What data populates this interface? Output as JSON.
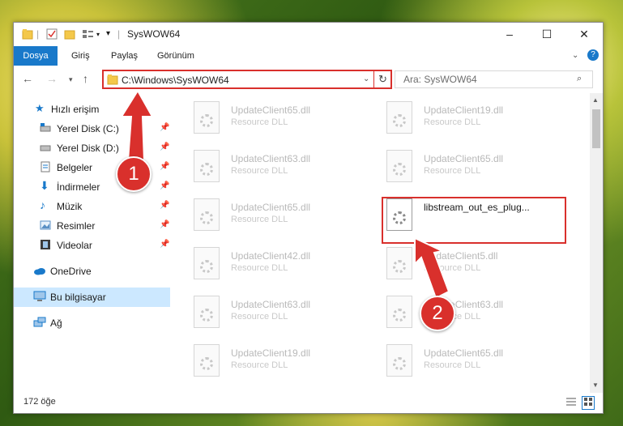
{
  "window": {
    "title": "SysWOW64",
    "controls": {
      "minimize": "–",
      "maximize": "☐",
      "close": "✕"
    }
  },
  "ribbon": {
    "tabs": [
      "Dosya",
      "Giriş",
      "Paylaş",
      "Görünüm"
    ],
    "help": "?"
  },
  "address": {
    "path": "C:\\Windows\\SysWOW64"
  },
  "search": {
    "placeholder": "Ara: SysWOW64"
  },
  "sidebar": {
    "quick_access": "Hızlı erişim",
    "items": [
      {
        "label": "Yerel Disk (C:)",
        "icon": "drive-icon",
        "pinned": true
      },
      {
        "label": "Yerel Disk (D:)",
        "icon": "drive-icon",
        "pinned": true
      },
      {
        "label": "Belgeler",
        "icon": "documents-icon",
        "pinned": true
      },
      {
        "label": "İndirmeler",
        "icon": "download-icon",
        "pinned": true
      },
      {
        "label": "Müzik",
        "icon": "music-icon",
        "pinned": true
      },
      {
        "label": "Resimler",
        "icon": "pictures-icon",
        "pinned": true
      },
      {
        "label": "Videolar",
        "icon": "videos-icon",
        "pinned": true
      }
    ],
    "onedrive": "OneDrive",
    "this_pc": "Bu bilgisayar",
    "network": "Ağ"
  },
  "files": [
    {
      "name": "UpdateClient65.dll",
      "type": "Resource DLL"
    },
    {
      "name": "UpdateClient19.dll",
      "type": "Resource DLL"
    },
    {
      "name": "UpdateClient63.dll",
      "type": "Resource DLL"
    },
    {
      "name": "UpdateClient65.dll",
      "type": "Resource DLL"
    },
    {
      "name": "UpdateClient65.dll",
      "type": "Resource DLL"
    },
    {
      "name": "libstream_out_es_plug...",
      "type": ""
    },
    {
      "name": "UpdateClient42.dll",
      "type": "Resource DLL"
    },
    {
      "name": "UpdateClient5.dll",
      "type": "Resource DLL"
    },
    {
      "name": "UpdateClient63.dll",
      "type": "Resource DLL"
    },
    {
      "name": "UpdateClient63.dll",
      "type": "Resource DLL"
    },
    {
      "name": "UpdateClient19.dll",
      "type": "Resource DLL"
    },
    {
      "name": "UpdateClient65.dll",
      "type": "Resource DLL"
    }
  ],
  "status": {
    "count": "172 öğe"
  },
  "callouts": [
    "1",
    "2"
  ],
  "colors": {
    "accent": "#1979ca",
    "highlight": "#d9302c",
    "selection": "#cce8ff"
  }
}
